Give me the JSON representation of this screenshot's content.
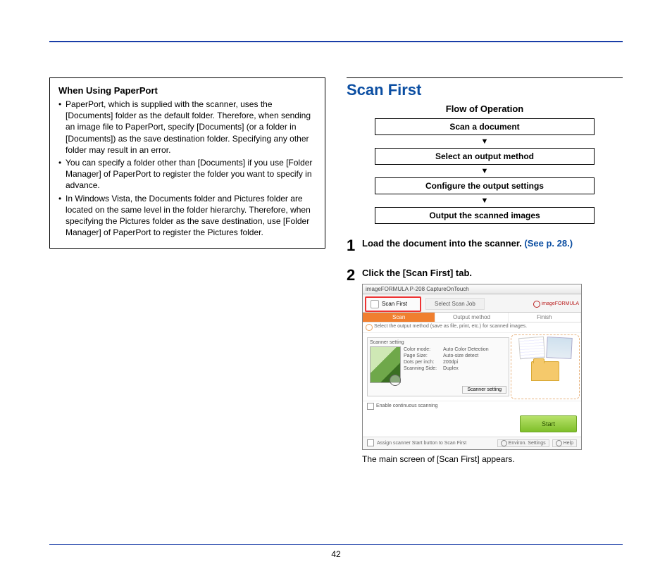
{
  "pageNumber": "42",
  "left": {
    "boxTitle": "When Using PaperPort",
    "bullets": [
      "PaperPort, which is supplied with the scanner, uses the [Documents] folder as the default folder. Therefore, when sending an image file to PaperPort, specify [Documents] (or a folder in [Documents]) as the save destination folder. Specifying any other folder may result in an error.",
      "You can specify a folder other than [Documents] if you use [Folder Manager] of PaperPort to register the folder you want to specify in advance.",
      "In Windows Vista, the Documents folder and Pictures folder are located on the same level in the folder hierarchy. Therefore, when specifying the Pictures folder as the save destination, use [Folder Manager] of PaperPort to register the Pictures folder."
    ]
  },
  "right": {
    "sectionTitle": "Scan First",
    "flowTitle": "Flow of Operation",
    "flow": [
      "Scan a document",
      "Select an output method",
      "Configure the output settings",
      "Output the scanned images"
    ],
    "steps": {
      "1": {
        "text": "Load the document into the scanner. ",
        "link": "(See p. 28.)"
      },
      "2": {
        "text": "Click the [Scan First] tab."
      }
    },
    "caption": "The main screen of [Scan First] appears.",
    "screenshot": {
      "windowTitle": "imageFORMULA P-208 CaptureOnTouch",
      "tab1": "Scan First",
      "tab2": "Select Scan Job",
      "brand": "imageFORMULA",
      "toolbar": {
        "scan": "Scan",
        "output": "Output method",
        "finish": "Finish"
      },
      "hint": "Select the output method (save as file, print, etc.) for scanned images.",
      "panelTitle": "Scanner setting",
      "settings": {
        "colorMode": {
          "label": "Color mode:",
          "value": "Auto Color Detection"
        },
        "pageSize": {
          "label": "Page Size:",
          "value": "Auto-size detect"
        },
        "dpi": {
          "label": "Dots per inch:",
          "value": "200dpi"
        },
        "side": {
          "label": "Scanning Side:",
          "value": "Duplex"
        }
      },
      "scannerSettingBtn": "Scanner setting",
      "continuousLabel": "Enable continuous scanning",
      "startBtn": "Start",
      "footerLeft": "Assign scanner Start button to Scan First",
      "envBtn": "Environ. Settings",
      "helpBtn": "Help"
    }
  }
}
